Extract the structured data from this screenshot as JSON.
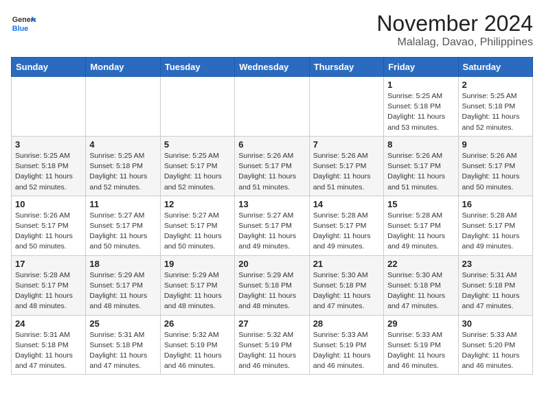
{
  "header": {
    "logo_general": "General",
    "logo_blue": "Blue",
    "month_year": "November 2024",
    "location": "Malalag, Davao, Philippines"
  },
  "weekdays": [
    "Sunday",
    "Monday",
    "Tuesday",
    "Wednesday",
    "Thursday",
    "Friday",
    "Saturday"
  ],
  "weeks": [
    [
      {
        "day": "",
        "sunrise": "",
        "sunset": "",
        "daylight": ""
      },
      {
        "day": "",
        "sunrise": "",
        "sunset": "",
        "daylight": ""
      },
      {
        "day": "",
        "sunrise": "",
        "sunset": "",
        "daylight": ""
      },
      {
        "day": "",
        "sunrise": "",
        "sunset": "",
        "daylight": ""
      },
      {
        "day": "",
        "sunrise": "",
        "sunset": "",
        "daylight": ""
      },
      {
        "day": "1",
        "sunrise": "Sunrise: 5:25 AM",
        "sunset": "Sunset: 5:18 PM",
        "daylight": "Daylight: 11 hours and 53 minutes."
      },
      {
        "day": "2",
        "sunrise": "Sunrise: 5:25 AM",
        "sunset": "Sunset: 5:18 PM",
        "daylight": "Daylight: 11 hours and 52 minutes."
      }
    ],
    [
      {
        "day": "3",
        "sunrise": "Sunrise: 5:25 AM",
        "sunset": "Sunset: 5:18 PM",
        "daylight": "Daylight: 11 hours and 52 minutes."
      },
      {
        "day": "4",
        "sunrise": "Sunrise: 5:25 AM",
        "sunset": "Sunset: 5:18 PM",
        "daylight": "Daylight: 11 hours and 52 minutes."
      },
      {
        "day": "5",
        "sunrise": "Sunrise: 5:25 AM",
        "sunset": "Sunset: 5:17 PM",
        "daylight": "Daylight: 11 hours and 52 minutes."
      },
      {
        "day": "6",
        "sunrise": "Sunrise: 5:26 AM",
        "sunset": "Sunset: 5:17 PM",
        "daylight": "Daylight: 11 hours and 51 minutes."
      },
      {
        "day": "7",
        "sunrise": "Sunrise: 5:26 AM",
        "sunset": "Sunset: 5:17 PM",
        "daylight": "Daylight: 11 hours and 51 minutes."
      },
      {
        "day": "8",
        "sunrise": "Sunrise: 5:26 AM",
        "sunset": "Sunset: 5:17 PM",
        "daylight": "Daylight: 11 hours and 51 minutes."
      },
      {
        "day": "9",
        "sunrise": "Sunrise: 5:26 AM",
        "sunset": "Sunset: 5:17 PM",
        "daylight": "Daylight: 11 hours and 50 minutes."
      }
    ],
    [
      {
        "day": "10",
        "sunrise": "Sunrise: 5:26 AM",
        "sunset": "Sunset: 5:17 PM",
        "daylight": "Daylight: 11 hours and 50 minutes."
      },
      {
        "day": "11",
        "sunrise": "Sunrise: 5:27 AM",
        "sunset": "Sunset: 5:17 PM",
        "daylight": "Daylight: 11 hours and 50 minutes."
      },
      {
        "day": "12",
        "sunrise": "Sunrise: 5:27 AM",
        "sunset": "Sunset: 5:17 PM",
        "daylight": "Daylight: 11 hours and 50 minutes."
      },
      {
        "day": "13",
        "sunrise": "Sunrise: 5:27 AM",
        "sunset": "Sunset: 5:17 PM",
        "daylight": "Daylight: 11 hours and 49 minutes."
      },
      {
        "day": "14",
        "sunrise": "Sunrise: 5:28 AM",
        "sunset": "Sunset: 5:17 PM",
        "daylight": "Daylight: 11 hours and 49 minutes."
      },
      {
        "day": "15",
        "sunrise": "Sunrise: 5:28 AM",
        "sunset": "Sunset: 5:17 PM",
        "daylight": "Daylight: 11 hours and 49 minutes."
      },
      {
        "day": "16",
        "sunrise": "Sunrise: 5:28 AM",
        "sunset": "Sunset: 5:17 PM",
        "daylight": "Daylight: 11 hours and 49 minutes."
      }
    ],
    [
      {
        "day": "17",
        "sunrise": "Sunrise: 5:28 AM",
        "sunset": "Sunset: 5:17 PM",
        "daylight": "Daylight: 11 hours and 48 minutes."
      },
      {
        "day": "18",
        "sunrise": "Sunrise: 5:29 AM",
        "sunset": "Sunset: 5:17 PM",
        "daylight": "Daylight: 11 hours and 48 minutes."
      },
      {
        "day": "19",
        "sunrise": "Sunrise: 5:29 AM",
        "sunset": "Sunset: 5:17 PM",
        "daylight": "Daylight: 11 hours and 48 minutes."
      },
      {
        "day": "20",
        "sunrise": "Sunrise: 5:29 AM",
        "sunset": "Sunset: 5:18 PM",
        "daylight": "Daylight: 11 hours and 48 minutes."
      },
      {
        "day": "21",
        "sunrise": "Sunrise: 5:30 AM",
        "sunset": "Sunset: 5:18 PM",
        "daylight": "Daylight: 11 hours and 47 minutes."
      },
      {
        "day": "22",
        "sunrise": "Sunrise: 5:30 AM",
        "sunset": "Sunset: 5:18 PM",
        "daylight": "Daylight: 11 hours and 47 minutes."
      },
      {
        "day": "23",
        "sunrise": "Sunrise: 5:31 AM",
        "sunset": "Sunset: 5:18 PM",
        "daylight": "Daylight: 11 hours and 47 minutes."
      }
    ],
    [
      {
        "day": "24",
        "sunrise": "Sunrise: 5:31 AM",
        "sunset": "Sunset: 5:18 PM",
        "daylight": "Daylight: 11 hours and 47 minutes."
      },
      {
        "day": "25",
        "sunrise": "Sunrise: 5:31 AM",
        "sunset": "Sunset: 5:18 PM",
        "daylight": "Daylight: 11 hours and 47 minutes."
      },
      {
        "day": "26",
        "sunrise": "Sunrise: 5:32 AM",
        "sunset": "Sunset: 5:19 PM",
        "daylight": "Daylight: 11 hours and 46 minutes."
      },
      {
        "day": "27",
        "sunrise": "Sunrise: 5:32 AM",
        "sunset": "Sunset: 5:19 PM",
        "daylight": "Daylight: 11 hours and 46 minutes."
      },
      {
        "day": "28",
        "sunrise": "Sunrise: 5:33 AM",
        "sunset": "Sunset: 5:19 PM",
        "daylight": "Daylight: 11 hours and 46 minutes."
      },
      {
        "day": "29",
        "sunrise": "Sunrise: 5:33 AM",
        "sunset": "Sunset: 5:19 PM",
        "daylight": "Daylight: 11 hours and 46 minutes."
      },
      {
        "day": "30",
        "sunrise": "Sunrise: 5:33 AM",
        "sunset": "Sunset: 5:20 PM",
        "daylight": "Daylight: 11 hours and 46 minutes."
      }
    ]
  ]
}
